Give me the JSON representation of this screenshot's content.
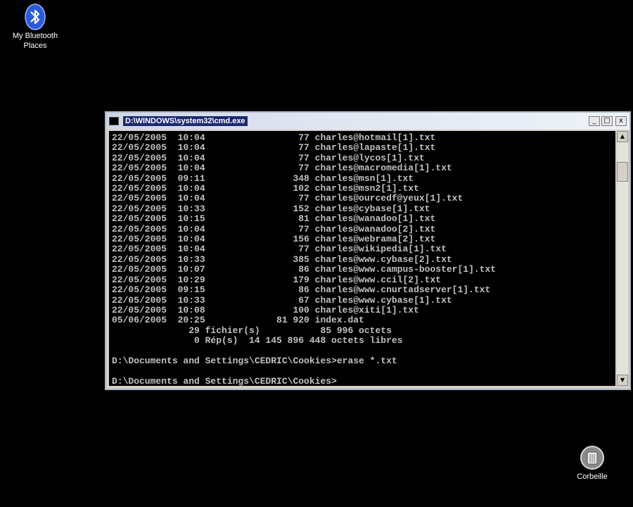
{
  "desktop": {
    "bluetooth_label_1": "My Bluetooth",
    "bluetooth_label_2": "Places",
    "recycle_label": "Corbeille"
  },
  "window": {
    "title": "D:\\WINDOWS\\system32\\cmd.exe",
    "minimize": "_",
    "maximize": "□",
    "close": "x"
  },
  "console": {
    "lines": [
      "22/05/2005  10:04                 77 charles@hotmail[1].txt",
      "22/05/2005  10:04                 77 charles@lapaste[1].txt",
      "22/05/2005  10:04                 77 charles@lycos[1].txt",
      "22/05/2005  10:04                 77 charles@macromedia[1].txt",
      "22/05/2005  09:11                348 charles@msn[1].txt",
      "22/05/2005  10:04                102 charles@msn2[1].txt",
      "22/05/2005  10:04                 77 charles@ourcedf@yeux[1].txt",
      "22/05/2005  10:33                152 charles@cybase[1].txt",
      "22/05/2005  10:15                 81 charles@wanadoo[1].txt",
      "22/05/2005  10:04                 77 charles@wanadoo[2].txt",
      "22/05/2005  10:04                156 charles@webrama[2].txt",
      "22/05/2005  10:04                 77 charles@wikipedia[1].txt",
      "22/05/2005  10:33                385 charles@www.cybase[2].txt",
      "22/05/2005  10:07                 86 charles@www.campus-booster[1].txt",
      "22/05/2005  10:29                179 charles@www.ccil[2].txt",
      "22/05/2005  09:15                 86 charles@www.cnurtadserver[1].txt",
      "22/05/2005  10:33                 67 charles@www.cybase[1].txt",
      "22/05/2005  10:08                100 charles@xiti[1].txt",
      "05/06/2005  20:25             81 920 index.dat",
      "              29 fichier(s)           85 996 octets",
      "               0 Rép(s)  14 145 896 448 octets libres",
      "",
      "D:\\Documents and Settings\\CEDRIC\\Cookies>erase *.txt",
      "",
      "D:\\Documents and Settings\\CEDRIC\\Cookies>"
    ]
  },
  "scrollbar": {
    "up": "▲",
    "down": "▼"
  }
}
